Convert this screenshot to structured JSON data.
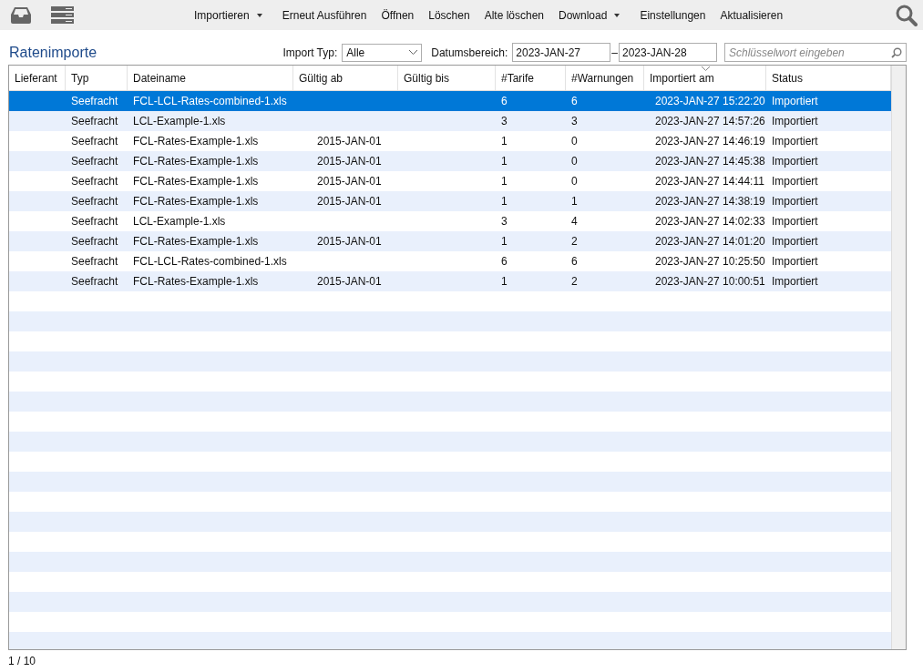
{
  "toolbar": {
    "actions": [
      {
        "label": "Importieren",
        "dropdown": true
      },
      {
        "label": "Erneut Ausführen",
        "dropdown": false
      },
      {
        "label": "Öffnen",
        "dropdown": false
      },
      {
        "label": "Löschen",
        "dropdown": false
      },
      {
        "label": "Alte löschen",
        "dropdown": false
      },
      {
        "label": "Download",
        "dropdown": true
      },
      {
        "label": "Einstellungen",
        "dropdown": false
      },
      {
        "label": "Aktualisieren",
        "dropdown": false
      }
    ]
  },
  "page_title": "Ratenimporte",
  "filters": {
    "import_type_label": "Import Typ:",
    "import_type_value": "Alle",
    "date_range_label": "Datumsbereich:",
    "date_from": "2023-JAN-27",
    "date_separator": "–",
    "date_to": "2023-JAN-28",
    "search_placeholder": "Schlüsselwort eingeben"
  },
  "table": {
    "columns": [
      {
        "label": "Lieferant",
        "sorted": false
      },
      {
        "label": "Typ",
        "sorted": false
      },
      {
        "label": "Dateiname",
        "sorted": false
      },
      {
        "label": "Gültig ab",
        "sorted": false
      },
      {
        "label": "Gültig bis",
        "sorted": false
      },
      {
        "label": "#Tarife",
        "sorted": false
      },
      {
        "label": "#Warnungen",
        "sorted": false
      },
      {
        "label": "Importiert am",
        "sorted": true
      },
      {
        "label": "Status",
        "sorted": false
      }
    ],
    "rows": [
      {
        "selected": true,
        "cells": [
          "",
          "Seefracht",
          "FCL-LCL-Rates-combined-1.xls",
          "",
          "",
          "6",
          "6",
          "2023-JAN-27 15:22:20",
          "Importiert"
        ]
      },
      {
        "selected": false,
        "cells": [
          "",
          "Seefracht",
          "LCL-Example-1.xls",
          "",
          "",
          "3",
          "3",
          "2023-JAN-27 14:57:26",
          "Importiert"
        ]
      },
      {
        "selected": false,
        "cells": [
          "",
          "Seefracht",
          "FCL-Rates-Example-1.xls",
          "2015-JAN-01",
          "",
          "1",
          "0",
          "2023-JAN-27 14:46:19",
          "Importiert"
        ]
      },
      {
        "selected": false,
        "cells": [
          "",
          "Seefracht",
          "FCL-Rates-Example-1.xls",
          "2015-JAN-01",
          "",
          "1",
          "0",
          "2023-JAN-27 14:45:38",
          "Importiert"
        ]
      },
      {
        "selected": false,
        "cells": [
          "",
          "Seefracht",
          "FCL-Rates-Example-1.xls",
          "2015-JAN-01",
          "",
          "1",
          "0",
          "2023-JAN-27 14:44:11",
          "Importiert"
        ]
      },
      {
        "selected": false,
        "cells": [
          "",
          "Seefracht",
          "FCL-Rates-Example-1.xls",
          "2015-JAN-01",
          "",
          "1",
          "1",
          "2023-JAN-27 14:38:19",
          "Importiert"
        ]
      },
      {
        "selected": false,
        "cells": [
          "",
          "Seefracht",
          "LCL-Example-1.xls",
          "",
          "",
          "3",
          "4",
          "2023-JAN-27 14:02:33",
          "Importiert"
        ]
      },
      {
        "selected": false,
        "cells": [
          "",
          "Seefracht",
          "FCL-Rates-Example-1.xls",
          "2015-JAN-01",
          "",
          "1",
          "2",
          "2023-JAN-27 14:01:20",
          "Importiert"
        ]
      },
      {
        "selected": false,
        "cells": [
          "",
          "Seefracht",
          "FCL-LCL-Rates-combined-1.xls",
          "",
          "",
          "6",
          "6",
          "2023-JAN-27 10:25:50",
          "Importiert"
        ]
      },
      {
        "selected": false,
        "cells": [
          "",
          "Seefracht",
          "FCL-Rates-Example-1.xls",
          "2015-JAN-01",
          "",
          "1",
          "2",
          "2023-JAN-27 10:00:51",
          "Importiert"
        ]
      }
    ]
  },
  "pagination": "1 / 10"
}
